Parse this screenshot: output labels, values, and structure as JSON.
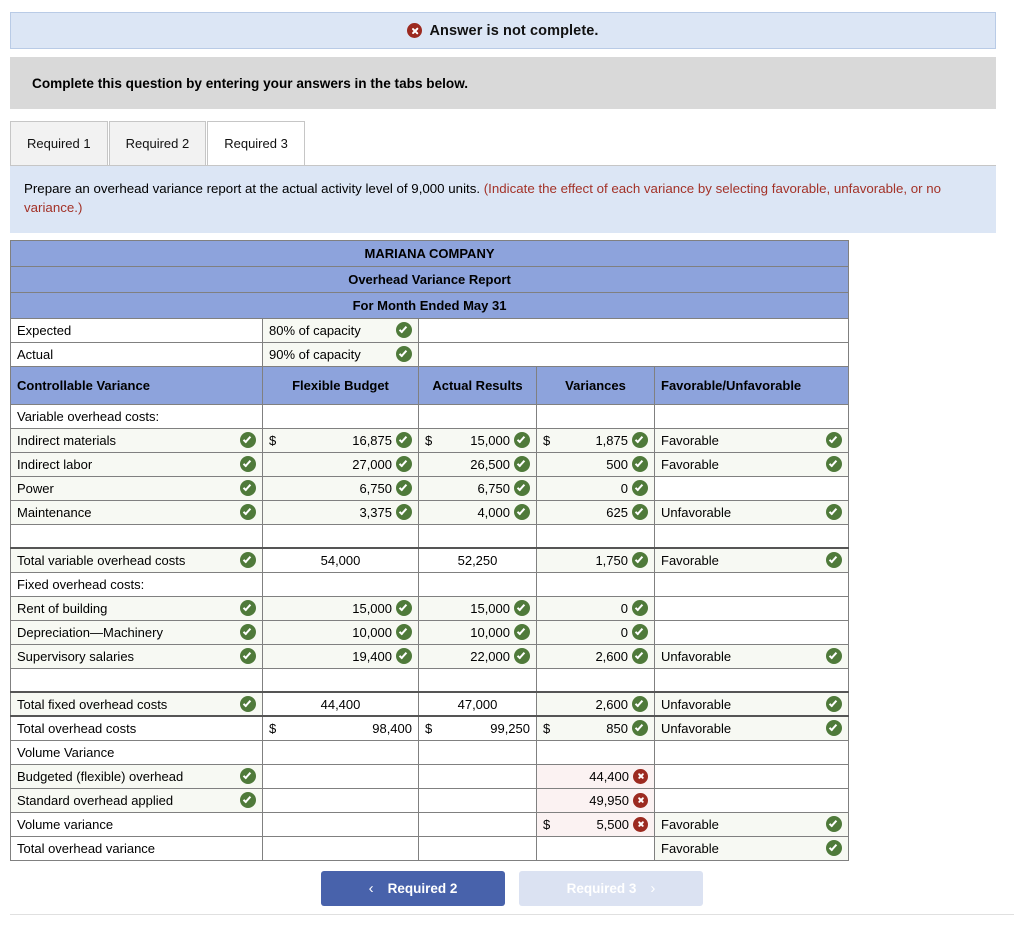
{
  "alert": {
    "icon": "x-circle-icon",
    "text": "Answer is not complete."
  },
  "instruction": {
    "text": "Complete this question by entering your answers in the tabs below."
  },
  "tabs": [
    {
      "label": "Required 1",
      "active": false
    },
    {
      "label": "Required 2",
      "active": false
    },
    {
      "label": "Required 3",
      "active": true
    }
  ],
  "prompt": {
    "main": "Prepare an overhead variance report at the actual activity level of 9,000 units. ",
    "hint": "(Indicate the effect of each variance by selecting favorable, unfavorable, or no variance.)"
  },
  "report": {
    "title_lines": [
      "MARIANA COMPANY",
      "Overhead Variance Report",
      "For Month Ended May 31"
    ],
    "capacity": [
      {
        "label": "Expected",
        "value": "80% of capacity",
        "status": "ok"
      },
      {
        "label": "Actual",
        "value": "90% of capacity",
        "status": "ok"
      }
    ],
    "columns": [
      "Controllable Variance",
      "Flexible Budget",
      "Actual Results",
      "Variances",
      "Favorable/Unfavorable"
    ],
    "rows": [
      {
        "type": "section",
        "label": "Variable overhead costs:",
        "label_status": "none"
      },
      {
        "type": "item",
        "indent": 1,
        "label": "Indirect materials",
        "label_status": "ok",
        "flexible": {
          "dollar": "$",
          "value": "16,875",
          "status": "ok"
        },
        "actual": {
          "dollar": "$",
          "value": "15,000",
          "status": "ok"
        },
        "variance": {
          "dollar": "$",
          "value": "1,875",
          "status": "ok"
        },
        "fav": {
          "value": "Favorable",
          "status": "ok"
        }
      },
      {
        "type": "item",
        "indent": 1,
        "label": "Indirect labor",
        "label_status": "ok",
        "flexible": {
          "dollar": "",
          "value": "27,000",
          "status": "ok"
        },
        "actual": {
          "dollar": "",
          "value": "26,500",
          "status": "ok"
        },
        "variance": {
          "dollar": "",
          "value": "500",
          "status": "ok"
        },
        "fav": {
          "value": "Favorable",
          "status": "ok"
        }
      },
      {
        "type": "item",
        "indent": 1,
        "label": "Power",
        "label_status": "ok",
        "flexible": {
          "dollar": "",
          "value": "6,750",
          "status": "ok"
        },
        "actual": {
          "dollar": "",
          "value": "6,750",
          "status": "ok"
        },
        "variance": {
          "dollar": "",
          "value": "0",
          "status": "ok"
        },
        "fav": {
          "value": "",
          "status": "none"
        }
      },
      {
        "type": "item",
        "indent": 1,
        "label": "Maintenance",
        "label_status": "ok",
        "flexible": {
          "dollar": "",
          "value": "3,375",
          "status": "ok"
        },
        "actual": {
          "dollar": "",
          "value": "4,000",
          "status": "ok"
        },
        "variance": {
          "dollar": "",
          "value": "625",
          "status": "ok"
        },
        "fav": {
          "value": "Unfavorable",
          "status": "ok"
        }
      },
      {
        "type": "spacer"
      },
      {
        "type": "total",
        "indent": 0,
        "label": "Total variable overhead costs",
        "label_status": "ok",
        "flexible": {
          "dollar": "",
          "value": "54,000",
          "status": "none",
          "align": "center"
        },
        "actual": {
          "dollar": "",
          "value": "52,250",
          "status": "none",
          "align": "center"
        },
        "variance": {
          "dollar": "",
          "value": "1,750",
          "status": "ok"
        },
        "fav": {
          "value": "Favorable",
          "status": "ok"
        }
      },
      {
        "type": "section",
        "label": "Fixed overhead costs:",
        "label_status": "none"
      },
      {
        "type": "item",
        "indent": 1,
        "label": "Rent of building",
        "label_status": "ok",
        "flexible": {
          "dollar": "",
          "value": "15,000",
          "status": "ok"
        },
        "actual": {
          "dollar": "",
          "value": "15,000",
          "status": "ok"
        },
        "variance": {
          "dollar": "",
          "value": "0",
          "status": "ok"
        },
        "fav": {
          "value": "",
          "status": "none"
        }
      },
      {
        "type": "item",
        "indent": 1,
        "label": "Depreciation—Machinery",
        "label_status": "ok",
        "flexible": {
          "dollar": "",
          "value": "10,000",
          "status": "ok"
        },
        "actual": {
          "dollar": "",
          "value": "10,000",
          "status": "ok"
        },
        "variance": {
          "dollar": "",
          "value": "0",
          "status": "ok"
        },
        "fav": {
          "value": "",
          "status": "none"
        }
      },
      {
        "type": "item",
        "indent": 1,
        "label": "Supervisory salaries",
        "label_status": "ok",
        "flexible": {
          "dollar": "",
          "value": "19,400",
          "status": "ok"
        },
        "actual": {
          "dollar": "",
          "value": "22,000",
          "status": "ok"
        },
        "variance": {
          "dollar": "",
          "value": "2,600",
          "status": "ok"
        },
        "fav": {
          "value": "Unfavorable",
          "status": "ok"
        }
      },
      {
        "type": "spacer"
      },
      {
        "type": "total",
        "indent": 1,
        "label": "Total fixed overhead costs",
        "label_status": "ok",
        "flexible": {
          "dollar": "",
          "value": "44,400",
          "status": "none",
          "align": "center"
        },
        "actual": {
          "dollar": "",
          "value": "47,000",
          "status": "none",
          "align": "center"
        },
        "variance": {
          "dollar": "",
          "value": "2,600",
          "status": "ok"
        },
        "fav": {
          "value": "Unfavorable",
          "status": "ok"
        }
      },
      {
        "type": "grand",
        "indent": 0,
        "label": "Total overhead costs",
        "label_status": "none",
        "flexible": {
          "dollar": "$",
          "value": "98,400",
          "status": "none"
        },
        "actual": {
          "dollar": "$",
          "value": "99,250",
          "status": "none"
        },
        "variance": {
          "dollar": "$",
          "value": "850",
          "status": "ok"
        },
        "fav": {
          "value": "Unfavorable",
          "status": "ok"
        }
      },
      {
        "type": "section",
        "label": "Volume Variance",
        "label_status": "none"
      },
      {
        "type": "item",
        "indent": 0,
        "label": "Budgeted (flexible) overhead",
        "label_status": "ok",
        "flexible": {
          "dollar": "",
          "value": "",
          "status": "none"
        },
        "actual": {
          "dollar": "",
          "value": "",
          "status": "none"
        },
        "variance": {
          "dollar": "",
          "value": "44,400",
          "status": "bad"
        },
        "fav": {
          "value": "",
          "status": "none"
        }
      },
      {
        "type": "item",
        "indent": 0,
        "label": "Standard overhead applied",
        "label_status": "ok",
        "flexible": {
          "dollar": "",
          "value": "",
          "status": "none"
        },
        "actual": {
          "dollar": "",
          "value": "",
          "status": "none"
        },
        "variance": {
          "dollar": "",
          "value": "49,950",
          "status": "bad"
        },
        "fav": {
          "value": "",
          "status": "none"
        }
      },
      {
        "type": "item",
        "indent": 0,
        "label": "Volume variance",
        "label_status": "none",
        "flexible": {
          "dollar": "",
          "value": "",
          "status": "none"
        },
        "actual": {
          "dollar": "",
          "value": "",
          "status": "none"
        },
        "variance": {
          "dollar": "$",
          "value": "5,500",
          "status": "bad"
        },
        "fav": {
          "value": "Favorable",
          "status": "ok"
        }
      },
      {
        "type": "item",
        "indent": 0,
        "label": "Total overhead variance",
        "label_status": "none",
        "flexible": {
          "dollar": "",
          "value": "",
          "status": "none"
        },
        "actual": {
          "dollar": "",
          "value": "",
          "status": "none"
        },
        "variance": {
          "dollar": "",
          "value": "",
          "status": "none"
        },
        "fav": {
          "value": "Favorable",
          "status": "ok"
        }
      }
    ]
  },
  "nav": {
    "prev": {
      "label": "Required 2",
      "chevron": "‹"
    },
    "next": {
      "label": "Required 3",
      "chevron": "›"
    }
  },
  "colors": {
    "header_blue": "#8da3dc",
    "banner_blue": "#dce6f5",
    "instruct_grey": "#d9d9d9",
    "check_green": "#4f7a3a",
    "x_red": "#9c2a20",
    "primary_btn": "#4862ab",
    "ghost_btn": "#dbe2f2",
    "hint_red": "#a33228"
  }
}
